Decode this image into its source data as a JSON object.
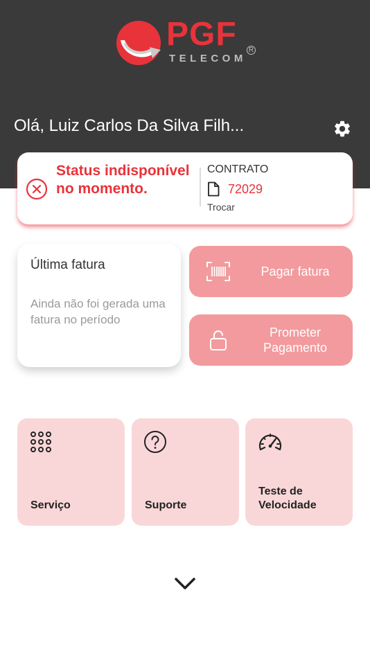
{
  "brand": {
    "name": "PGF",
    "subtitle": "TELECOM",
    "registered": "R",
    "accent_color": "#e8333a"
  },
  "header": {
    "greeting": "Olá, Luiz Carlos Da Silva Filh...",
    "settings_icon": "gear-icon"
  },
  "status": {
    "message": "Status indisponível no momento.",
    "icon": "close-circle-icon"
  },
  "contract": {
    "label": "CONTRATO",
    "number": "72029",
    "change_label": "Trocar",
    "icon": "document-icon"
  },
  "invoice": {
    "title": "Última fatura",
    "description": "Ainda não foi gerada uma fatura no período"
  },
  "actions": {
    "pay_label": "Pagar fatura",
    "pay_icon": "barcode-icon",
    "promise_label": "Prometer Pagamento",
    "promise_icon": "unlock-icon"
  },
  "tiles": [
    {
      "label": "Serviço",
      "icon": "grid-dots-icon"
    },
    {
      "label": "Suporte",
      "icon": "help-circle-icon"
    },
    {
      "label": "Teste de\nVelocidade",
      "icon": "speedometer-icon"
    }
  ],
  "footer": {
    "expand_icon": "chevron-down-icon"
  }
}
